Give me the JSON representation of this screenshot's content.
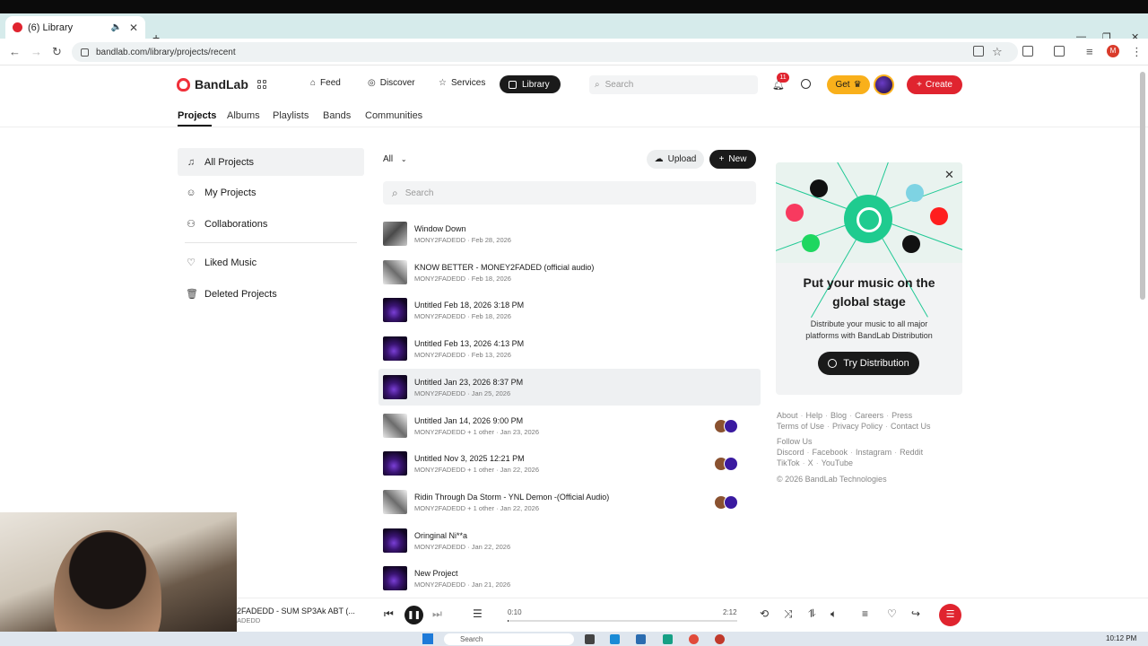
{
  "browser": {
    "tab_title": "(6) Library",
    "url": "bandlab.com/library/projects/recent",
    "profile_initial": "M"
  },
  "header": {
    "logo": "BandLab",
    "nav": [
      {
        "label": "Feed",
        "icon": "home-icon"
      },
      {
        "label": "Discover",
        "icon": "compass-icon"
      },
      {
        "label": "Services",
        "icon": "star-icon"
      },
      {
        "label": "Library",
        "icon": "library-icon",
        "active": true
      }
    ],
    "search_placeholder": "Search",
    "notification_count": "11",
    "get_label": "Get",
    "create_label": "Create"
  },
  "subnav": [
    "Projects",
    "Albums",
    "Playlists",
    "Bands",
    "Communities"
  ],
  "sidebar": [
    {
      "label": "All Projects",
      "icon": "music-note-icon",
      "active": true
    },
    {
      "label": "My Projects",
      "icon": "person-icon"
    },
    {
      "label": "Collaborations",
      "icon": "people-icon"
    },
    {
      "label": "Liked Music",
      "icon": "heart-icon"
    },
    {
      "label": "Deleted Projects",
      "icon": "trash-icon"
    }
  ],
  "list": {
    "filter_label": "All",
    "upload_label": "Upload",
    "new_label": "New",
    "search_placeholder": "Search",
    "projects": [
      {
        "title": "Window Down",
        "meta": "MONY2FADEDD · Feb 28, 2026",
        "thumb": "photo",
        "collab": false
      },
      {
        "title": "KNOW BETTER - MONEY2FADED (official audio)",
        "meta": "MONY2FADEDD · Feb 18, 2026",
        "thumb": "photo2",
        "collab": false
      },
      {
        "title": "Untitled Feb 18, 2026 3:18 PM",
        "meta": "MONY2FADEDD · Feb 18, 2026",
        "thumb": "purple",
        "collab": false
      },
      {
        "title": "Untitled Feb 13, 2026 4:13 PM",
        "meta": "MONY2FADEDD · Feb 13, 2026",
        "thumb": "purple",
        "collab": false
      },
      {
        "title": "Untitled Jan 23, 2026 8:37 PM",
        "meta": "MONY2FADEDD · Jan 25, 2026",
        "thumb": "purple",
        "collab": false
      },
      {
        "title": "Untitled Jan 14, 2026 9:00 PM",
        "meta": "MONY2FADEDD + 1 other · Jan 23, 2026",
        "thumb": "photo2",
        "collab": true
      },
      {
        "title": "Untitled Nov 3, 2025 12:21 PM",
        "meta": "MONY2FADEDD + 1 other · Jan 22, 2026",
        "thumb": "purple",
        "collab": true
      },
      {
        "title": "Ridin Through Da Storm - YNL Demon -(Official Audio)",
        "meta": "MONY2FADEDD + 1 other · Jan 22, 2026",
        "thumb": "photo2",
        "collab": true
      },
      {
        "title": "Oringinal Ni**a",
        "meta": "MONY2FADEDD · Jan 22, 2026",
        "thumb": "purple",
        "collab": false
      },
      {
        "title": "New Project",
        "meta": "MONY2FADEDD · Jan 21, 2026",
        "thumb": "purple",
        "collab": false
      }
    ]
  },
  "promo": {
    "title_line1": "Put your music on the",
    "title_line2": "global stage",
    "subtitle_line1": "Distribute your music to all major",
    "subtitle_line2": "platforms with BandLab Distribution",
    "button": "Try Distribution"
  },
  "footer": {
    "row1": [
      "About",
      "Help",
      "Blog",
      "Careers",
      "Press"
    ],
    "row2": [
      "Terms of Use",
      "Privacy Policy",
      "Contact Us"
    ],
    "follow": "Follow Us",
    "row3": [
      "Discord",
      "Facebook",
      "Instagram",
      "Reddit"
    ],
    "row4": [
      "TikTok",
      "X",
      "YouTube"
    ],
    "copyright": "© 2026 BandLab Technologies"
  },
  "player": {
    "title": "2FADEDD - SUM SP3Ak ABT (...",
    "artist": "ADEDD",
    "current_time": "0:10",
    "duration": "2:12",
    "progress_fraction": 0.005
  },
  "taskbar": {
    "search_placeholder": "Search",
    "clock": "10:12 PM"
  },
  "colors": {
    "brand_red": "#e0242f",
    "get_yellow": "#f9b01b",
    "distribution_green": "#1fcb8f"
  }
}
